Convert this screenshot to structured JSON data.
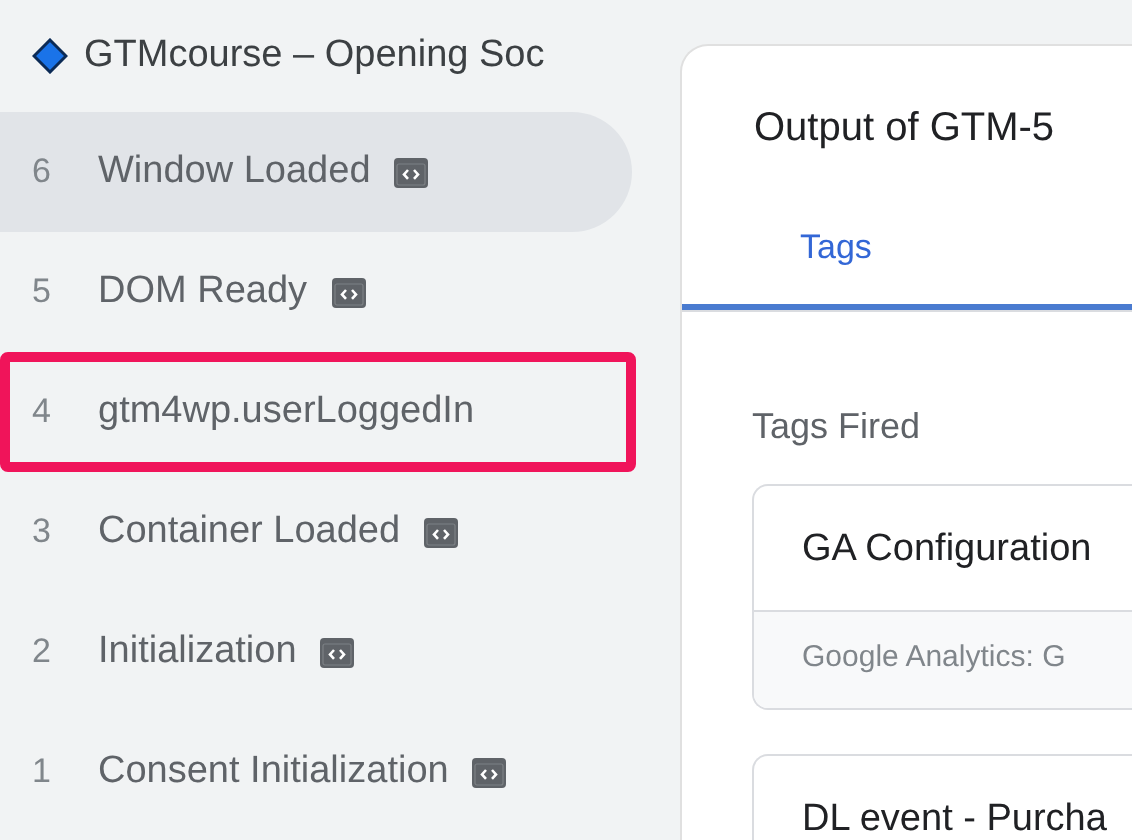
{
  "sidebar": {
    "title": "GTMcourse – Opening Soc",
    "events": [
      {
        "number": "6",
        "label": "Window Loaded",
        "code_icon": true,
        "selected": true,
        "highlighted": false
      },
      {
        "number": "5",
        "label": "DOM Ready",
        "code_icon": true,
        "selected": false,
        "highlighted": false
      },
      {
        "number": "4",
        "label": "gtm4wp.userLoggedIn",
        "code_icon": false,
        "selected": false,
        "highlighted": true
      },
      {
        "number": "3",
        "label": "Container Loaded",
        "code_icon": true,
        "selected": false,
        "highlighted": false
      },
      {
        "number": "2",
        "label": "Initialization",
        "code_icon": true,
        "selected": false,
        "highlighted": false
      },
      {
        "number": "1",
        "label": "Consent Initialization",
        "code_icon": true,
        "selected": false,
        "highlighted": false
      }
    ]
  },
  "panel": {
    "title": "Output of GTM-5",
    "tabs": [
      {
        "label": "Tags",
        "selected": true
      }
    ],
    "section_title": "Tags Fired",
    "tags": [
      {
        "name": "GA Configuration",
        "type": "Google Analytics: G"
      },
      {
        "name": "DL event - Purcha"
      }
    ]
  }
}
